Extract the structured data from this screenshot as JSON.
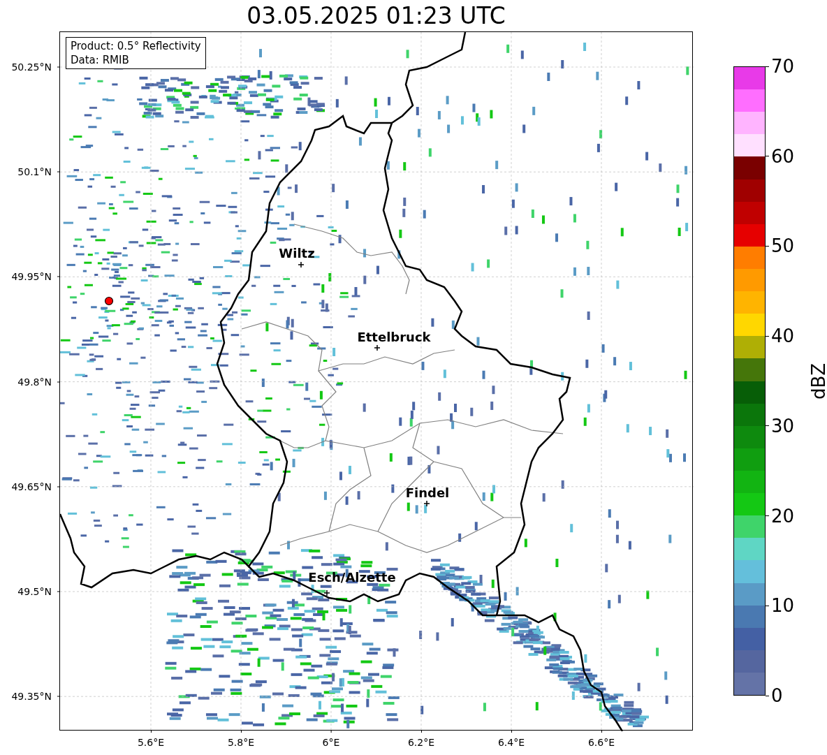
{
  "title": "03.05.2025 01:23 UTC",
  "info_box": {
    "lines": [
      "Product: 0.5° Reflectivity",
      "Data: RMIB"
    ]
  },
  "map": {
    "y_ticks": [
      "50.25°N",
      "50.1°N",
      "49.95°N",
      "49.8°N",
      "49.65°N",
      "49.5°N",
      "49.35°N"
    ],
    "x_ticks": [
      "5.6°E",
      "5.8°E",
      "6°E",
      "6.2°E",
      "6.4°E",
      "6.6°E"
    ],
    "cities": [
      {
        "name": "Wiltz"
      },
      {
        "name": "Ettelbruck"
      },
      {
        "name": "Findel"
      },
      {
        "name": "Esch/Alzette"
      }
    ]
  },
  "colorbar": {
    "label": "dBZ",
    "ticks": [
      "70",
      "60",
      "50",
      "40",
      "30",
      "20",
      "10",
      "0"
    ],
    "levels": [
      {
        "color": "#e83ae8"
      },
      {
        "color": "#ff6eff"
      },
      {
        "color": "#ffb4ff"
      },
      {
        "color": "#ffe0ff"
      },
      {
        "color": "#7a0000"
      },
      {
        "color": "#a00000"
      },
      {
        "color": "#c00000"
      },
      {
        "color": "#e60000"
      },
      {
        "color": "#ff7d00"
      },
      {
        "color": "#ff9a00"
      },
      {
        "color": "#ffb400"
      },
      {
        "color": "#ffd700"
      },
      {
        "color": "#afaf05"
      },
      {
        "color": "#45760a"
      },
      {
        "color": "#075e07"
      },
      {
        "color": "#0b760b"
      },
      {
        "color": "#0e8a0e"
      },
      {
        "color": "#109e10"
      },
      {
        "color": "#12b412"
      },
      {
        "color": "#14c814"
      },
      {
        "color": "#3fd46a"
      },
      {
        "color": "#5fd6c4"
      },
      {
        "color": "#64bfdb"
      },
      {
        "color": "#5a9bc6"
      },
      {
        "color": "#4a79b1"
      },
      {
        "color": "#4460a4"
      },
      {
        "color": "#55669f"
      },
      {
        "color": "#6473a7"
      }
    ]
  }
}
